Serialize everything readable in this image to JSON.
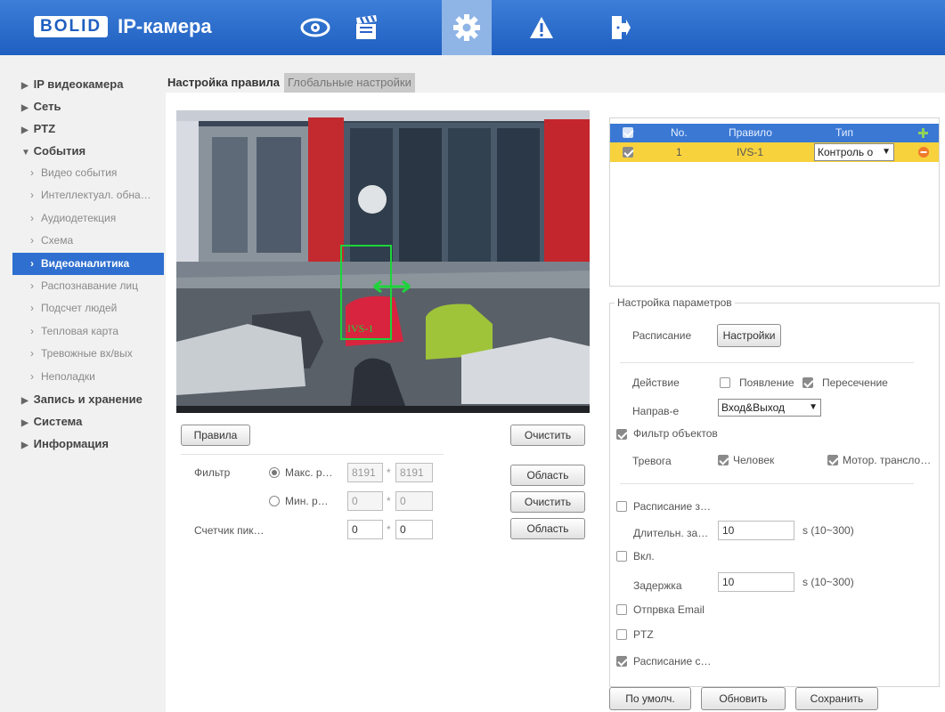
{
  "header": {
    "brand": "BOLID",
    "title": "IP-камера",
    "nav": [
      "live-view-icon",
      "playback-icon",
      "settings-icon",
      "alarm-icon",
      "logout-icon"
    ]
  },
  "sidebar": {
    "items": [
      {
        "label": "IP видеокамера",
        "expanded": false
      },
      {
        "label": "Сеть",
        "expanded": false
      },
      {
        "label": "PTZ",
        "expanded": false
      },
      {
        "label": "События",
        "expanded": true
      },
      {
        "label": "Запись и хранение",
        "expanded": false
      },
      {
        "label": "Система",
        "expanded": false
      },
      {
        "label": "Информация",
        "expanded": false
      }
    ],
    "events_sub": [
      "Видео события",
      "Интеллектуал. обна…",
      "Аудиодетекция",
      "Схема",
      "Видеоаналитика",
      "Распознавание лиц",
      "Подсчет людей",
      "Тепловая карта",
      "Тревожные вх/вых",
      "Неполадки"
    ]
  },
  "tabs": {
    "rule": "Настройка правила",
    "global": "Глобальные настройки"
  },
  "video": {
    "ivs_label": "IVS-1"
  },
  "controls": {
    "rules_button": "Правила",
    "clear_button": "Очистить",
    "filter_label": "Фильтр",
    "max_label": "Макс. р…",
    "max_w": "8191",
    "max_h": "8191",
    "area_button": "Область",
    "min_label": "Мин. р…",
    "min_w": "0",
    "min_h": "0",
    "clear_button_2": "Очистить",
    "pixel_counter": "Счетчик пик…",
    "px_w": "0",
    "px_h": "0",
    "area_button_2": "Область",
    "times": "*"
  },
  "rules_table": {
    "headers": {
      "no": "No.",
      "rule": "Правило",
      "type": "Тип"
    },
    "rows": [
      {
        "no": "1",
        "rule": "IVS-1",
        "type": "Контроль о"
      }
    ]
  },
  "params": {
    "title": "Настройка параметров",
    "schedule_label": "Расписание",
    "schedule_button": "Настройки",
    "action_label": "Действие",
    "appear": "Появление",
    "cross": "Пересечение",
    "direction_label": "Направ-е",
    "direction_value": "Вход&Выход",
    "object_filter": "Фильтр объектов",
    "alarm_label": "Тревога",
    "human": "Человек",
    "motor": "Мотор. трансло…",
    "record_schedule": "Расписание з…",
    "duration_label": "Длительн. за…",
    "duration_value": "10",
    "duration_range": "s (10~300)",
    "enable": "Вкл.",
    "delay_label": "Задержка",
    "delay_value": "10",
    "delay_range": "s (10~300)",
    "email": "Отпрвка Email",
    "ptz": "PTZ",
    "snapshot": "Расписание с…"
  },
  "footer": {
    "default": "По умолч.",
    "refresh": "Обновить",
    "save": "Сохранить"
  },
  "colors": {
    "header": "#2f6fd0",
    "active": "#2e6fd0",
    "rule_row": "#f7d23c",
    "ivs_box": "#1ed43a"
  }
}
